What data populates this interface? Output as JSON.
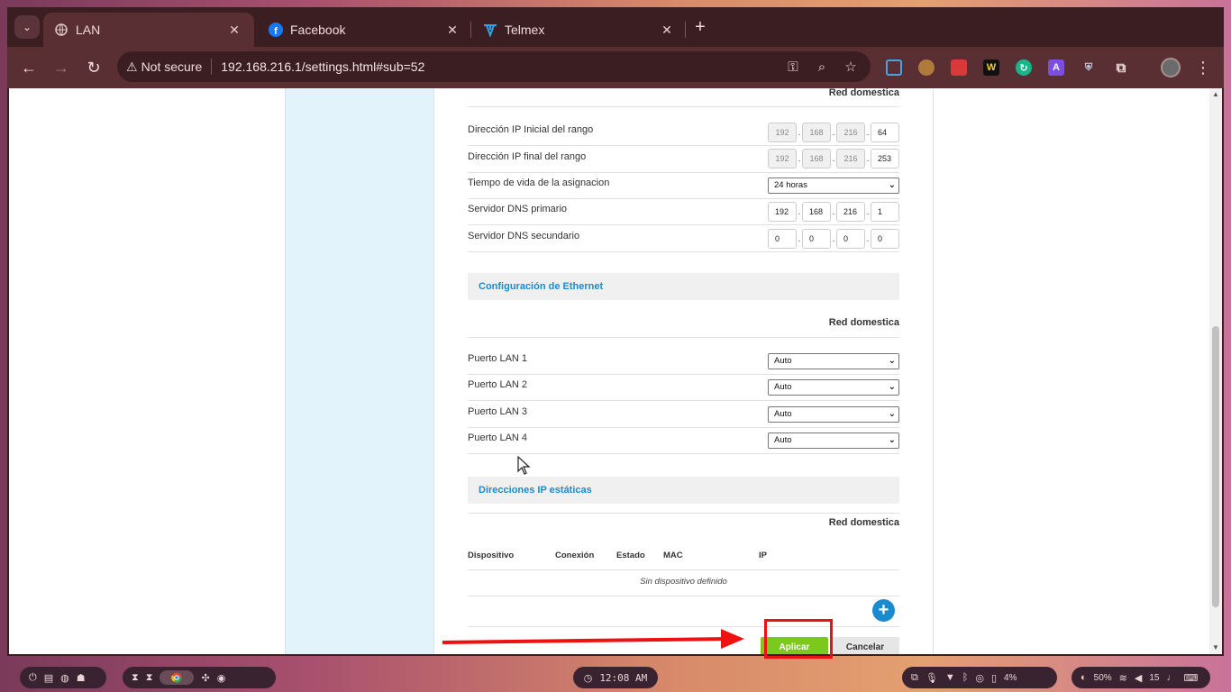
{
  "browser": {
    "tabs": [
      {
        "title": "LAN",
        "icon": "globe-icon",
        "active": true
      },
      {
        "title": "Facebook",
        "icon": "facebook-icon",
        "active": false
      },
      {
        "title": "Telmex",
        "icon": "telmex-icon",
        "active": false
      }
    ],
    "security_label": "Not secure",
    "url": "192.168.216.1/settings.html#sub=52"
  },
  "page": {
    "top_label": "Red domestica",
    "dhcp_rows": [
      {
        "label": "Dirección IP Inicial del rango",
        "ip": [
          "192",
          "168",
          "216",
          "64"
        ]
      },
      {
        "label": "Dirección IP final del rango",
        "ip": [
          "192",
          "168",
          "216",
          "253"
        ]
      },
      {
        "label": "Tiempo de vida de la asignacion",
        "select": "24 horas"
      },
      {
        "label": "Servidor DNS primario",
        "ip": [
          "192",
          "168",
          "216",
          "1"
        ]
      },
      {
        "label": "Servidor DNS secundario",
        "ip": [
          "0",
          "0",
          "0",
          "0"
        ]
      }
    ],
    "ethernet": {
      "title": "Configuración de Ethernet",
      "subheader": "Red domestica",
      "ports": [
        {
          "label": "Puerto LAN 1",
          "value": "Auto"
        },
        {
          "label": "Puerto LAN 2",
          "value": "Auto"
        },
        {
          "label": "Puerto LAN 3",
          "value": "Auto"
        },
        {
          "label": "Puerto LAN 4",
          "value": "Auto"
        }
      ]
    },
    "static": {
      "title": "Direcciones IP estáticas",
      "subheader": "Red domestica",
      "columns": [
        "Dispositivo",
        "Conexión",
        "Estado",
        "MAC",
        "IP"
      ],
      "empty_text": "Sin dispositivo definido"
    },
    "apply_label": "Aplicar",
    "cancel_label": "Cancelar"
  },
  "shelf": {
    "clock": "12:08 AM",
    "battery": "4%",
    "brightness": "50%",
    "volume": "15"
  },
  "colors": {
    "accent_blue": "#1b8bd0",
    "apply_green": "#7bc91a",
    "annotation_red": "#ee1111"
  }
}
